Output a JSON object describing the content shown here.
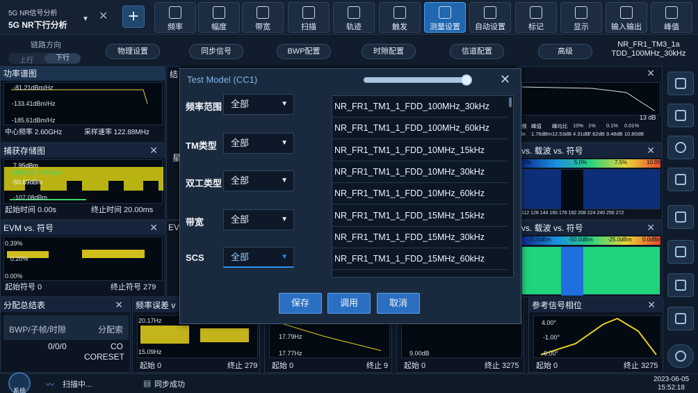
{
  "mode": {
    "title": "5G NR信号分析",
    "name": "5G NR下行分析"
  },
  "toolbar": [
    {
      "label": "频率",
      "icon": "frequency-icon"
    },
    {
      "label": "幅度",
      "icon": "amplitude-icon"
    },
    {
      "label": "带宽",
      "icon": "bandwidth-icon"
    },
    {
      "label": "扫描",
      "icon": "sweep-icon"
    },
    {
      "label": "轨迹",
      "icon": "trace-icon"
    },
    {
      "label": "触发",
      "icon": "trigger-icon"
    },
    {
      "label": "测量设置",
      "icon": "measure-setup-icon",
      "active": true
    },
    {
      "label": "自动设置",
      "icon": "auto-setup-icon"
    },
    {
      "label": "标记",
      "icon": "marker-icon"
    },
    {
      "label": "显示",
      "icon": "display-icon"
    },
    {
      "label": "输入输出",
      "icon": "io-icon"
    },
    {
      "label": "峰值",
      "icon": "peak-icon"
    }
  ],
  "linkdir": {
    "title": "链路方向",
    "up": "上行",
    "down": "下行"
  },
  "subtabs": [
    "物理设置",
    "同步信号",
    "BWP配置",
    "时隙配置",
    "信道配置",
    "高级"
  ],
  "tm_name": {
    "line1": "NR_FR1_TM3_1a",
    "line2": "TDD_100MHz_30kHz"
  },
  "panels": {
    "spectrum": {
      "title": "功率谱图",
      "y1": "-81.21dBm/Hz",
      "y2": "-133.41dBm/Hz",
      "y3": "-185.61dBm/Hz",
      "f1": "中心频率 2.60GHz",
      "f2": "采样速率 122.88MHz"
    },
    "capture": {
      "title": "捕获存储图",
      "y1": "7.95dBm",
      "y2": "-50.89dBm",
      "y3": "-107.08dBm",
      "marker": "持续时间: 1.9326ms",
      "f1": "起始时间 0.00s",
      "f2": "终止时间 20.00ms"
    },
    "evm_sym": {
      "title": "EVM vs. 符号",
      "y1": "0.39%",
      "y2": "0.20%",
      "y3": "0.00%",
      "f1": "起始符号 0",
      "f2": "终止符号 279"
    },
    "alloc": {
      "title": "分配总结表",
      "h1": "BWP/子帧/时隙",
      "h2": "分配索",
      "r1a": "0/0/0",
      "r1b": "CO",
      "r2b": "CORESET"
    },
    "freq_err": {
      "title": "频率误差 v",
      "y1": "20.17Hz",
      "y2": "15.09Hz",
      "f1": "起始 0",
      "f2": "终止 279"
    },
    "p6": {
      "y1": "17.79Hz",
      "y2": "17.77Hz",
      "f1": "起始 0",
      "f2": "终止 9"
    },
    "p7": {
      "y1": "9.00dB",
      "f1": "起始 0",
      "f2": "终止 3275"
    },
    "ref_phase": {
      "title": "参考信号相位",
      "y1": "4.00°",
      "y2": "-1.00°",
      "y3": "-6.00°",
      "f1": "起始 0",
      "f2": "终止 3275"
    },
    "right_top": {
      "vals": [
        "13 dB"
      ],
      "row1": [
        "频",
        "峰值",
        "峰均比",
        "10%",
        "1%",
        "0.1%",
        "0.01%"
      ],
      "row2": [
        "ln",
        "1.76dBm",
        "12.53dB",
        "4.31dB",
        "7.62dB",
        "9.48dB",
        "10.80dB"
      ]
    },
    "evm_car": {
      "title": "vs. 载波 vs. 符号",
      "scale": [
        "2.5%",
        "5.0%",
        "7.5%",
        "10.0%"
      ],
      "xt": "112 128 144 160 176 192 208 224 240 256 272"
    },
    "pow_car": {
      "title": "vs. 载波 vs. 符号",
      "scale": [
        "-75.0dBm",
        "-50.0dBm",
        "-25.0dBm",
        "0.0dBm"
      ]
    },
    "mid_label": "结",
    "ev2": "EV",
    "star": "星"
  },
  "dialog": {
    "title": "Test Model (CC1)",
    "filters": [
      {
        "label": "频率范围",
        "value": "全部"
      },
      {
        "label": "TM类型",
        "value": "全部"
      },
      {
        "label": "双工类型",
        "value": "全部"
      },
      {
        "label": "带宽",
        "value": "全部"
      },
      {
        "label": "SCS",
        "value": "全部"
      }
    ],
    "items": [
      "NR_FR1_TM1_1_FDD_100MHz_30kHz",
      "NR_FR1_TM1_1_FDD_100MHz_60kHz",
      "NR_FR1_TM1_1_FDD_10MHz_15kHz",
      "NR_FR1_TM1_1_FDD_10MHz_30kHz",
      "NR_FR1_TM1_1_FDD_10MHz_60kHz",
      "NR_FR1_TM1_1_FDD_15MHz_15kHz",
      "NR_FR1_TM1_1_FDD_15MHz_30kHz",
      "NR_FR1_TM1_1_FDD_15MHz_60kHz"
    ],
    "buttons": {
      "save": "保存",
      "load": "调用",
      "cancel": "取消"
    }
  },
  "status": {
    "sys": "系统",
    "scan": "扫描中...",
    "sync": "同步成功",
    "date": "2023-06-05",
    "time": "15:52:18"
  }
}
